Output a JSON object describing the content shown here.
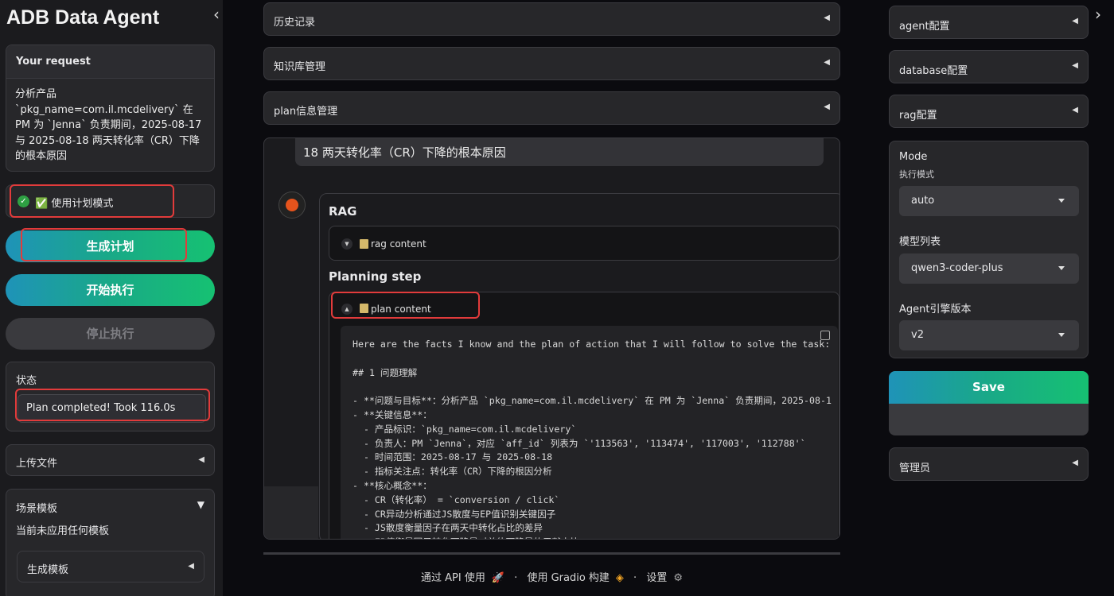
{
  "app": {
    "title": "ADB Data Agent",
    "collapse_left": "‹",
    "collapse_right": "›"
  },
  "request": {
    "title": "Your request",
    "text": "分析产品 `pkg_name=com.il.mcdelivery` 在 PM 为 `Jenna` 负责期间，2025-08-17 与 2025-08-18 两天转化率（CR）下降的根本原因"
  },
  "plan_mode": {
    "label": "✅ 使用计划模式",
    "check_icon": "check-circle-icon"
  },
  "buttons": {
    "generate": "生成计划",
    "start": "开始执行",
    "stop": "停止执行"
  },
  "status": {
    "title": "状态",
    "value": "Plan completed! Took 116.0s"
  },
  "upload": {
    "label": "上传文件"
  },
  "scene": {
    "title": "场景模板",
    "subtitle": "当前未应用任何模板",
    "generate_template": "生成模板"
  },
  "middle": {
    "accordions": [
      "历史记录",
      "知识库管理",
      "plan信息管理"
    ],
    "user_message_tail": "18 两天转化率（CR）下降的根本原因",
    "rag_heading": "RAG",
    "rag_content": "rag content",
    "planning_heading": "Planning step",
    "plan_content": "plan content",
    "plan_text": "Here are the facts I know and the plan of action that I will follow to solve the task:\n\n## 1 问题理解\n\n- **问题与目标**：分析产品 `pkg_name=com.il.mcdelivery` 在 PM 为 `Jenna` 负责期间，2025-08-1\n- **关键信息**：\n  - 产品标识：`pkg_name=com.il.mcdelivery`\n  - 负责人：PM `Jenna`，对应 `aff_id` 列表为 `'113563', '113474', '117003', '112788'`\n  - 时间范围：2025-08-17 与 2025-08-18\n  - 指标关注点：转化率（CR）下降的根因分析\n- **核心概念**：\n  - CR（转化率） = `conversion / click`\n  - CR异动分析通过JS散度与EP值识别关键因子\n  - JS散度衡量因子在两天中转化占比的差异\n  - EP值衡量因子转化下降量对总体下降量的贡献占比"
  },
  "footer": {
    "api": "通过 API 使用",
    "gradio": "使用 Gradio 构建",
    "settings": "设置",
    "sep": "·"
  },
  "right": {
    "accordions": [
      "agent配置",
      "database配置",
      "rag配置"
    ],
    "mode_label": "Mode",
    "mode_sub": "执行模式",
    "mode_value": "auto",
    "model_label": "模型列表",
    "model_value": "qwen3-coder-plus",
    "engine_label": "Agent引擎版本",
    "engine_value": "v2",
    "save": "Save",
    "admin": "管理员"
  },
  "colors": {
    "accent_start": "#1f93b8",
    "accent_end": "#16c172",
    "highlight": "#e23b3b",
    "background": "#0b0b0f"
  }
}
